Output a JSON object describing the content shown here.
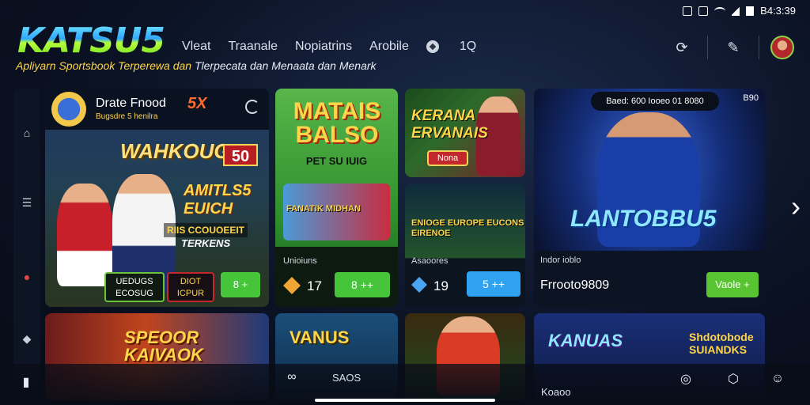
{
  "status": {
    "time": "B4:3:39"
  },
  "header": {
    "logo": "KATSU5",
    "tagline_yellow": "Apliyarn Sportsbook Terperewa dan",
    "tagline_white": "Tlerpecata dan Menaata dan Menark",
    "nav": [
      "Vleat",
      "Traanale",
      "Nopiatrins",
      "Arobile"
    ],
    "nav_extra": "1Q"
  },
  "cards": {
    "c1": {
      "title": "Drate Fnood",
      "subtitle": "Bugsdre 5 henilra",
      "badge": "5X",
      "big": "WAHKOUG",
      "big_num": "50",
      "promo": "AMITLS5 EUICH",
      "promo2": "RIIS CCOUOEEIT",
      "promo3": "TERKENS",
      "btn1": "UEDUGS ECOSUG",
      "btn2": "DIOT ICPUR",
      "btn3": "8 +"
    },
    "c2": {
      "title": "MATAIS BALSO",
      "sub": "PET SU IUIG",
      "art_label": "FANATIK MIDHAN",
      "label": "Unioiuns",
      "num": "17",
      "btn": "8 ++"
    },
    "c3": {
      "title": "KERANA ERVANAIS",
      "btn": "Nona"
    },
    "c4": {
      "title": "ENIOGE EUROPE EUCONS EIRENOE",
      "label": "Asaoores",
      "num": "19",
      "btn": "5 ++"
    },
    "c5": {
      "pill": "Baed: 600 Iooeo 01 8080",
      "save": "B90",
      "title": "LANTOBBU5",
      "label": "Indor ioblo",
      "num": "Frrooto9809",
      "btn": "Vaole +"
    }
  },
  "row2": {
    "a": "SPEOOR KAIVAOK",
    "b": "VANUS",
    "d": "KANUAS",
    "d2": "Shdotobode SUIANDKS"
  },
  "bottom": {
    "label1": "SAOS",
    "label2": "Koaoo"
  }
}
